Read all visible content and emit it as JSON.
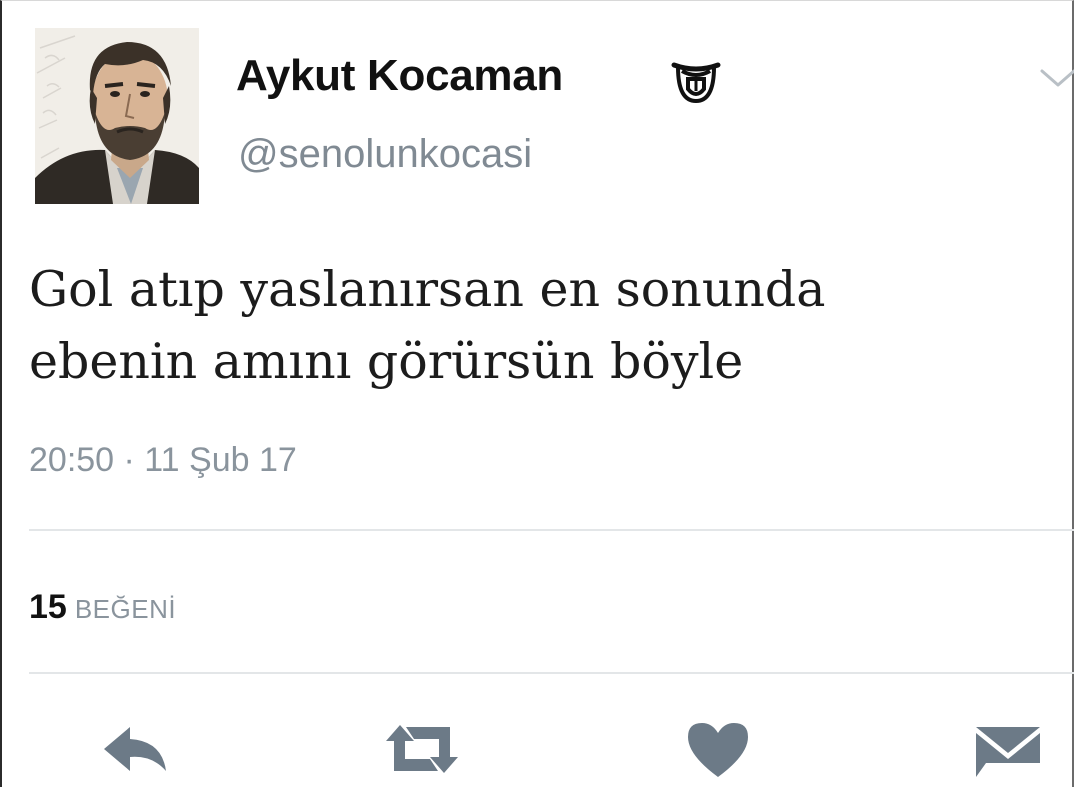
{
  "user": {
    "display_name": "Aykut Kocaman",
    "handle": "@senolunkocasi",
    "badge_icon": "tongue-out-emoji-icon",
    "avatar": "bearded-man-portrait-illustration"
  },
  "tweet": {
    "text_line_1": "Gol atıp yaslanırsan en sonunda",
    "text_line_2": "ebenin amını görürsün böyle",
    "timestamp": "20:50 · 11 Şub 17"
  },
  "stats": {
    "likes_count": "15",
    "likes_label": "BEĞENİ"
  },
  "actions": [
    {
      "icon": "reply-icon"
    },
    {
      "icon": "retweet-icon"
    },
    {
      "icon": "heart-icon"
    },
    {
      "icon": "direct-message-icon"
    }
  ],
  "colors": {
    "icon_gray": "#6c7a87",
    "secondary_text": "#808a93",
    "divider": "#e3e6e8"
  }
}
